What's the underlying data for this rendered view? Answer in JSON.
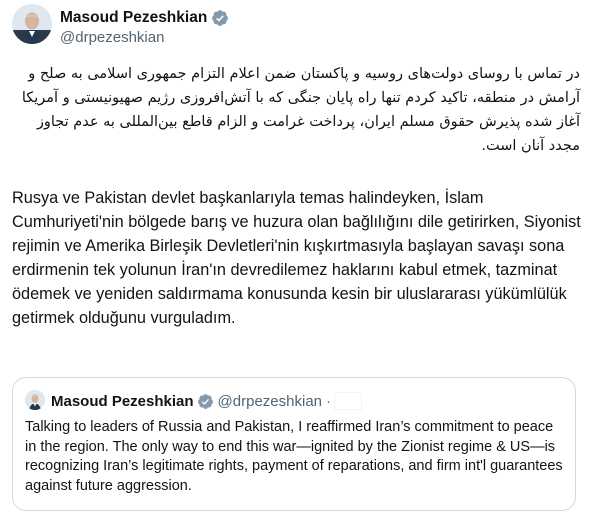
{
  "author": {
    "name": "Masoud Pezeshkian",
    "handle": "@drpezeshkian"
  },
  "post": {
    "farsi_text": "در تماس با روسای دولت‌های روسیه و پاکستان ضمن اعلام التزام جمهوری اسلامی به صلح و آرامش در منطقه، تاکید کردم تنها راه پایان جنگی که با آتش‌افروزی رژیم صهیونیستی و آمریکا آغاز شده پذیرش حقوق مسلم ایران، پرداخت غرامت و الزام قاطع بین‌المللی به عدم تجاوز مجدد آنان است.",
    "turkish_text": "Rusya ve Pakistan devlet başkanlarıyla temas halindeyken, İslam Cumhuriyeti'nin bölgede barış ve huzura olan bağlılığını dile getirirken, Siyonist rejimin ve Amerika Birleşik Devletleri'nin kışkırtmasıyla başlayan savaşı sona erdirmenin tek yolunun İran'ın devredilemez haklarını kabul etmek, tazminat ödemek ve yeniden saldırmama konusunda kesin bir uluslararası yükümlülük getirmek olduğunu vurguladım."
  },
  "quoted": {
    "name": "Masoud Pezeshkian",
    "handle": "@drpezeshkian",
    "separator": "·",
    "text": "Talking to leaders of Russia and Pakistan, I reaffirmed Iran’s commitment to peace in the region. The only way to end this war—ignited by the Zionist regime & US—is recognizing Iran’s legitimate rights, payment of reparations, and firm int'l guarantees against future aggression."
  },
  "icons": {
    "avatar": "avatar-image",
    "verified": "verified-badge-icon"
  },
  "colors": {
    "verified_gray": "#829aab",
    "secondary_text": "#536471",
    "border": "#cfd9de"
  }
}
